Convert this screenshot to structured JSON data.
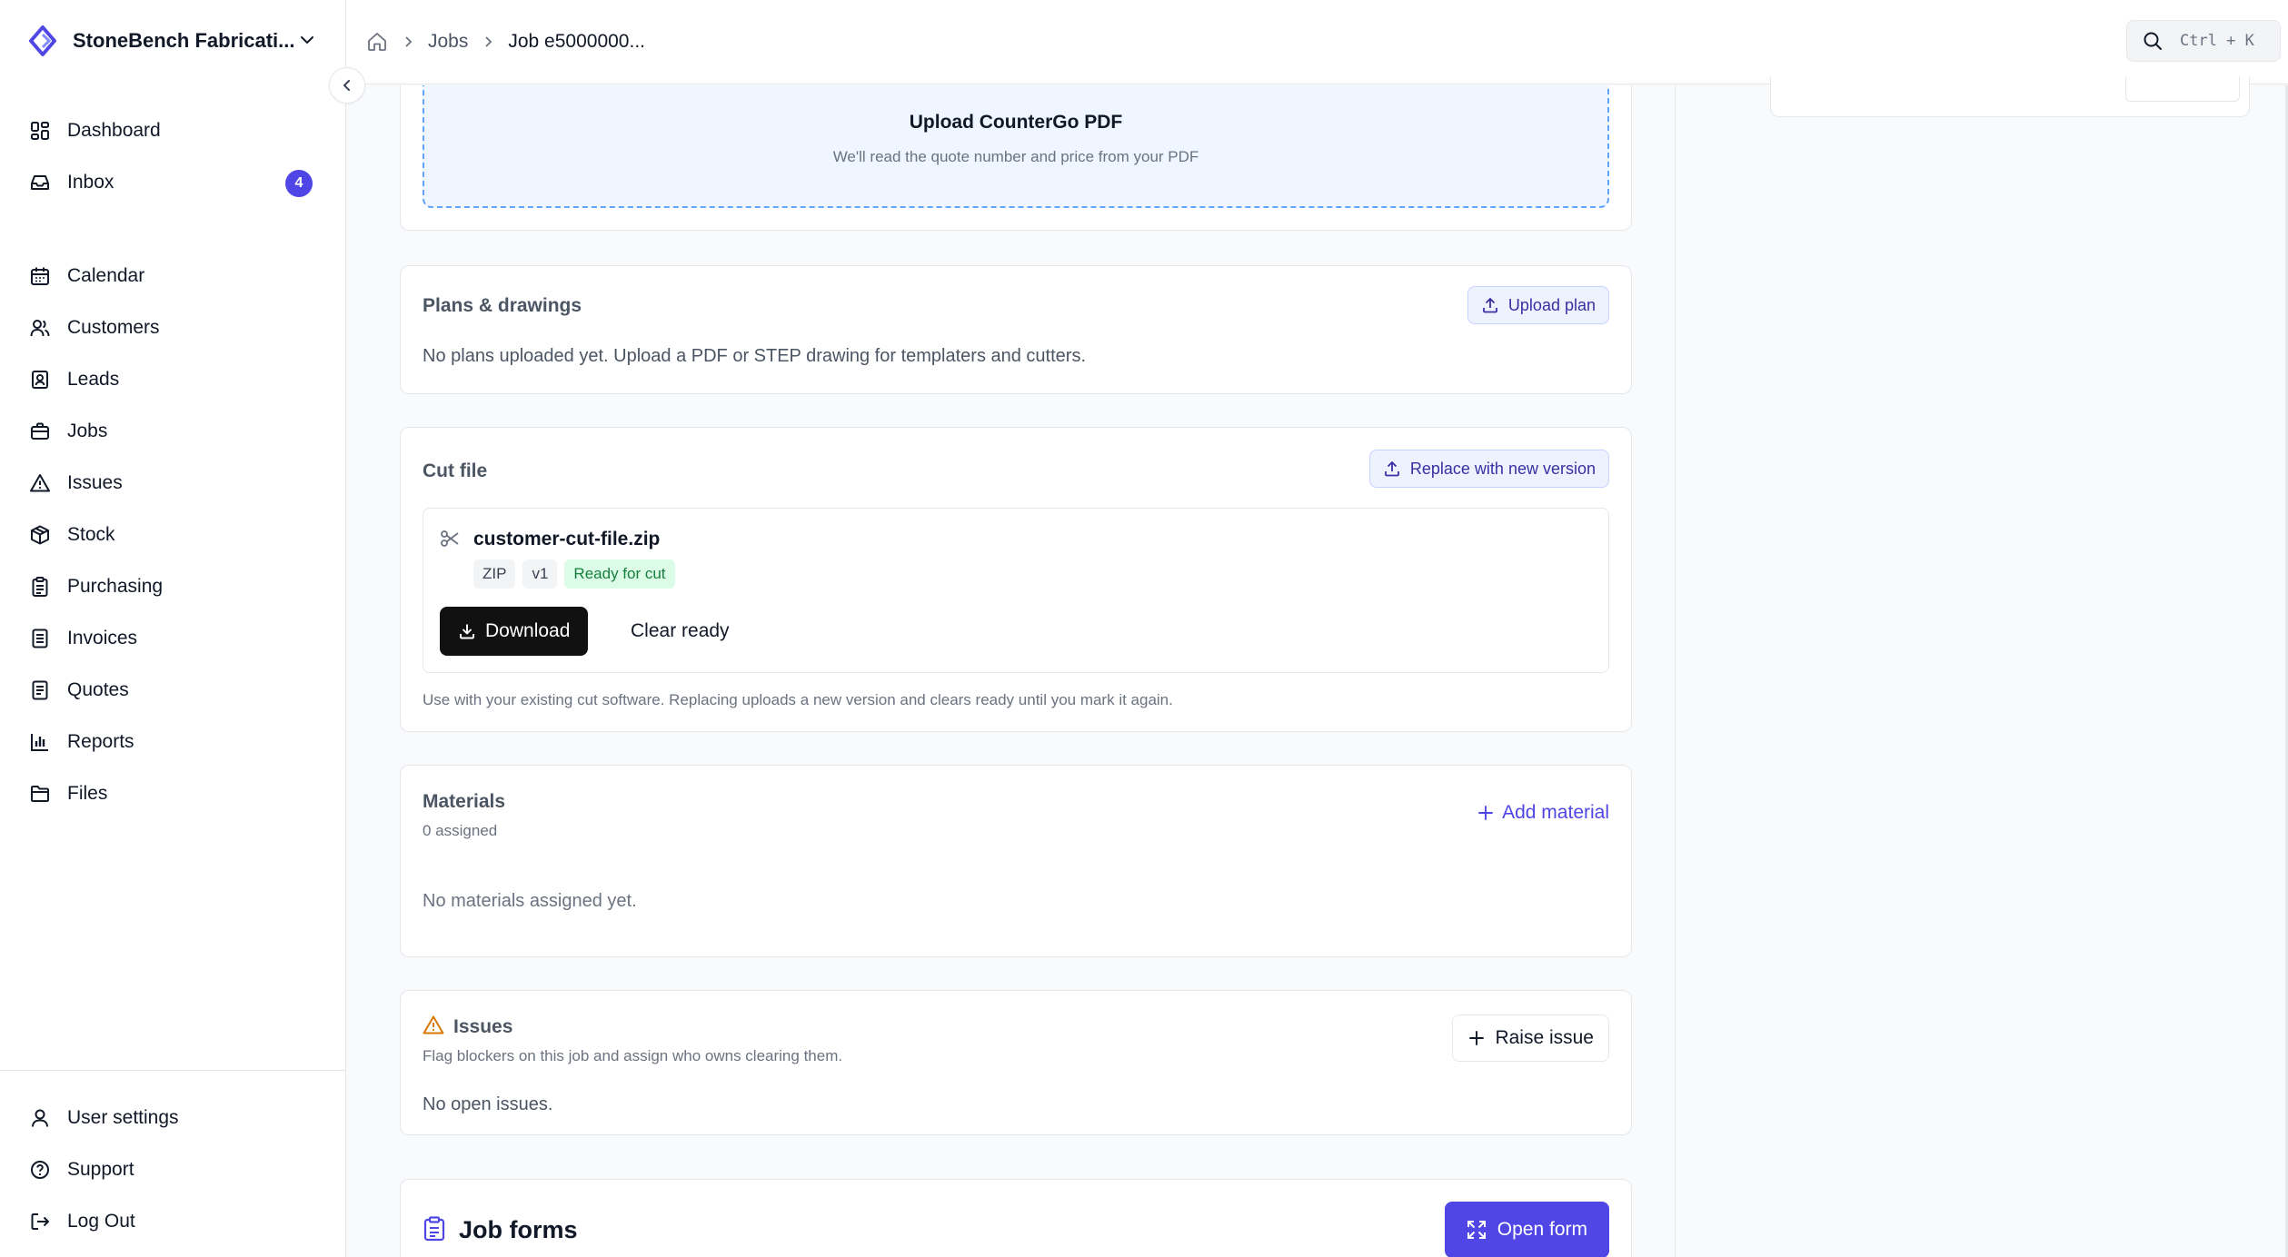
{
  "org": {
    "name": "StoneBench Fabricati...",
    "logo_icon": "diamond-logo-icon",
    "accent": "#4f46e5"
  },
  "sidebar": {
    "items": [
      {
        "label": "Dashboard",
        "icon": "dashboard-icon"
      },
      {
        "label": "Inbox",
        "icon": "inbox-icon",
        "badge": "4"
      },
      {
        "label": "Calendar",
        "icon": "calendar-icon"
      },
      {
        "label": "Customers",
        "icon": "users-icon"
      },
      {
        "label": "Leads",
        "icon": "contact-icon"
      },
      {
        "label": "Jobs",
        "icon": "briefcase-icon"
      },
      {
        "label": "Issues",
        "icon": "warning-icon"
      },
      {
        "label": "Stock",
        "icon": "box-icon"
      },
      {
        "label": "Purchasing",
        "icon": "clipboard-icon"
      },
      {
        "label": "Invoices",
        "icon": "invoice-icon"
      },
      {
        "label": "Quotes",
        "icon": "quote-icon"
      },
      {
        "label": "Reports",
        "icon": "bar-chart-icon"
      },
      {
        "label": "Files",
        "icon": "folder-icon"
      }
    ],
    "footer": [
      {
        "label": "User settings",
        "icon": "user-icon"
      },
      {
        "label": "Support",
        "icon": "help-icon"
      },
      {
        "label": "Log Out",
        "icon": "logout-icon"
      }
    ]
  },
  "header": {
    "breadcrumbs": [
      "Jobs",
      "Job e5000000..."
    ],
    "search_shortcut": "Ctrl + K"
  },
  "upload": {
    "title": "Upload CounterGo PDF",
    "subtitle": "We'll read the quote number and price from your PDF"
  },
  "plans": {
    "title": "Plans & drawings",
    "button": "Upload plan",
    "empty": "No plans uploaded yet. Upload a PDF or STEP drawing for templaters and cutters."
  },
  "cut_file": {
    "title": "Cut file",
    "replace_button": "Replace with new version",
    "filename": "customer-cut-file.zip",
    "tags": {
      "type": "ZIP",
      "version": "v1",
      "status": "Ready for cut"
    },
    "download": "Download",
    "clear": "Clear ready",
    "note": "Use with your existing cut software. Replacing uploads a new version and clears ready until you mark it again."
  },
  "materials": {
    "title": "Materials",
    "count": "0 assigned",
    "add": "Add material",
    "empty": "No materials assigned yet."
  },
  "issues": {
    "title": "Issues",
    "subtitle": "Flag blockers on this job and assign who owns clearing them.",
    "raise": "Raise issue",
    "empty": "No open issues."
  },
  "forms": {
    "title": "Job forms",
    "open": "Open form"
  }
}
